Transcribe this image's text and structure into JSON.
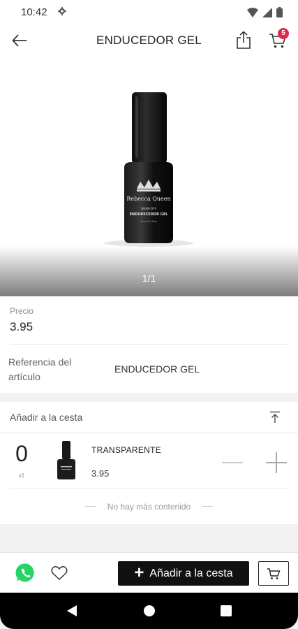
{
  "status_bar": {
    "time": "10:42"
  },
  "header": {
    "title": "ENDUCEDOR GEL",
    "cart_count": "5"
  },
  "product_image": {
    "counter": "1/1",
    "bottle_brand": "Rebecca Queen",
    "bottle_line1": "SOAK-OFF",
    "bottle_line2": "ENDURECEDOR GEL",
    "bottle_line3": "15ml 0.5 fl.oz"
  },
  "info": {
    "price_label": "Precio",
    "price_value": "3.95",
    "reference_label": "Referencia del artículo",
    "reference_value": "ENDUCEDOR GEL"
  },
  "basket": {
    "title": "Añadir a la cesta",
    "quantity": "0",
    "multiplier": "x1",
    "variant_name": "TRANSPARENTE",
    "variant_price": "3.95",
    "end_text": "No hay más contenido"
  },
  "action_bar": {
    "add_label": "Añadir a la cesta"
  },
  "colors": {
    "badge": "#e0284a",
    "whatsapp": "#25d366",
    "button_bg": "#111111"
  }
}
